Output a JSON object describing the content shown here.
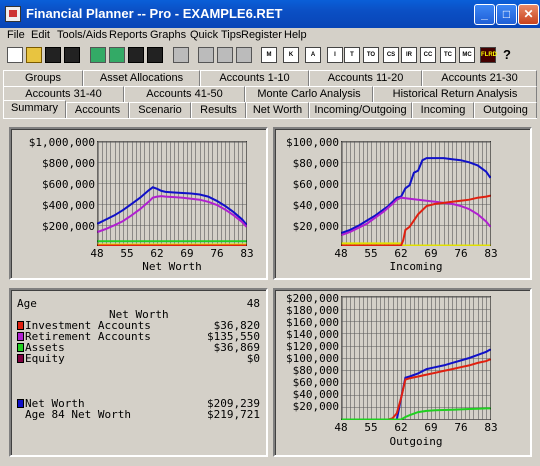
{
  "window": {
    "title": "Financial Planner -- Pro - EXAMPLE6.RET",
    "min": "_",
    "max": "□",
    "close": "✕"
  },
  "menu": [
    "File",
    "Edit",
    "Tools/Aids",
    "Reports",
    "Graphs",
    "Quick Tips",
    "Register",
    "Help"
  ],
  "toolbar": {
    "labeled_buttons": [
      "M",
      "K",
      "A",
      "I",
      "T",
      "TO",
      "CS",
      "IR",
      "CC",
      "TC",
      "MC",
      "FLRD"
    ],
    "other_icons": [
      "new-icon",
      "open-icon",
      "save-icon",
      "save-as-icon",
      "import-icon",
      "export-icon",
      "save-copy-icon",
      "save-all-icon",
      "print-icon",
      "print-setup-icon",
      "print-preview-icon",
      "print-report-icon",
      "help-icon"
    ]
  },
  "tabs": {
    "row1": [
      "Groups",
      "Asset Allocations",
      "Accounts 1-10",
      "Accounts 11-20",
      "Accounts 21-30"
    ],
    "row2": [
      "Accounts 31-40",
      "Accounts 41-50",
      "Monte Carlo Analysis",
      "Historical Return Analysis"
    ],
    "row3": [
      "Summary",
      "Accounts",
      "Scenario",
      "Results",
      "Net Worth",
      "Incoming/Outgoing",
      "Incoming",
      "Outgoing"
    ],
    "active": "Summary"
  },
  "colors": {
    "blue": "#1010c8",
    "purple": "#b020d0",
    "red": "#e02010",
    "green": "#20d020",
    "yellow": "#e0e000",
    "maroon": "#800040"
  },
  "chart_data": [
    {
      "type": "line",
      "xlabel": "Net Worth",
      "x_ticks": [
        "48",
        "55",
        "62",
        "69",
        "76",
        "83"
      ],
      "y_ticks": [
        "$1,000,000",
        "$800,000",
        "$600,000",
        "$400,000",
        "$200,000"
      ],
      "xlim": [
        48,
        83
      ],
      "ylim": [
        0,
        1000000
      ],
      "series": [
        {
          "color": "#1010c8",
          "x": [
            48,
            50,
            52,
            54,
            56,
            58,
            60,
            61,
            62,
            63,
            64,
            66,
            68,
            70,
            72,
            74,
            76,
            78,
            80,
            82,
            83
          ],
          "values": [
            210000,
            250000,
            290000,
            340000,
            400000,
            460000,
            530000,
            560000,
            545000,
            525000,
            515000,
            510000,
            505000,
            500000,
            490000,
            470000,
            430000,
            380000,
            320000,
            250000,
            200000
          ]
        },
        {
          "color": "#b020d0",
          "x": [
            48,
            50,
            52,
            54,
            56,
            58,
            60,
            61,
            62,
            63,
            64,
            66,
            68,
            70,
            72,
            74,
            76,
            78,
            80,
            82,
            83
          ],
          "values": [
            130000,
            160000,
            195000,
            235000,
            290000,
            350000,
            420000,
            460000,
            470000,
            475000,
            470000,
            465000,
            460000,
            450000,
            440000,
            420000,
            390000,
            345000,
            290000,
            225000,
            180000
          ]
        },
        {
          "color": "#20d020",
          "x": [
            48,
            83
          ],
          "values": [
            40000,
            40000
          ]
        },
        {
          "color": "#e0e000",
          "x": [
            48,
            83
          ],
          "values": [
            10000,
            10000
          ]
        },
        {
          "color": "#e02010",
          "x": [
            48,
            83
          ],
          "values": [
            0,
            0
          ]
        }
      ]
    },
    {
      "type": "line",
      "xlabel": "Incoming",
      "x_ticks": [
        "48",
        "55",
        "62",
        "69",
        "76",
        "83"
      ],
      "y_ticks": [
        "$100,000",
        "$80,000",
        "$60,000",
        "$40,000",
        "$20,000"
      ],
      "xlim": [
        48,
        83
      ],
      "ylim": [
        0,
        100000
      ],
      "series": [
        {
          "color": "#1010c8",
          "x": [
            48,
            50,
            52,
            54,
            56,
            58,
            59,
            60,
            61,
            62,
            63,
            64,
            65,
            66,
            67,
            68,
            70,
            72,
            74,
            76,
            78,
            80,
            82,
            83
          ],
          "values": [
            12000,
            15000,
            19000,
            24000,
            29000,
            35000,
            38000,
            42000,
            46000,
            47000,
            55000,
            58000,
            70000,
            72000,
            82000,
            84000,
            84000,
            84000,
            83000,
            82000,
            80000,
            77000,
            71000,
            65000
          ]
        },
        {
          "color": "#b020d0",
          "x": [
            48,
            50,
            52,
            54,
            56,
            58,
            60,
            61,
            62,
            64,
            66,
            68,
            70,
            72,
            74,
            76,
            78,
            80,
            82,
            83
          ],
          "values": [
            10000,
            13000,
            17000,
            21000,
            27000,
            33000,
            40000,
            44000,
            46000,
            45000,
            44000,
            43000,
            42000,
            41000,
            40000,
            38000,
            35000,
            30000,
            23000,
            18000
          ]
        },
        {
          "color": "#e0e000",
          "x": [
            48,
            62,
            62.1,
            83
          ],
          "values": [
            2000,
            2000,
            0,
            0
          ]
        },
        {
          "color": "#e02010",
          "x": [
            48,
            62,
            62.5,
            63,
            64,
            66,
            68,
            70,
            72,
            74,
            76,
            78,
            80,
            82,
            83
          ],
          "values": [
            0,
            0,
            5000,
            15000,
            18000,
            30000,
            38000,
            40000,
            41000,
            42000,
            43000,
            44000,
            46000,
            47000,
            48000
          ]
        }
      ]
    },
    {
      "type": "line",
      "xlabel": "Outgoing",
      "x_ticks": [
        "48",
        "55",
        "62",
        "69",
        "76",
        "83"
      ],
      "y_ticks": [
        "$200,000",
        "$180,000",
        "$160,000",
        "$140,000",
        "$120,000",
        "$100,000",
        "$80,000",
        "$60,000",
        "$40,000",
        "$20,000"
      ],
      "xlim": [
        48,
        83
      ],
      "ylim": [
        0,
        200000
      ],
      "series": [
        {
          "color": "#1010c8",
          "x": [
            48,
            61,
            62,
            63,
            64,
            66,
            68,
            70,
            72,
            74,
            76,
            78,
            80,
            82,
            83
          ],
          "values": [
            0,
            0,
            35000,
            68000,
            70000,
            75000,
            82000,
            85000,
            88000,
            92000,
            96000,
            100000,
            105000,
            110000,
            114000
          ]
        },
        {
          "color": "#e02010",
          "x": [
            48,
            59,
            60,
            61,
            62,
            63,
            64,
            66,
            68,
            70,
            72,
            74,
            76,
            78,
            80,
            82,
            83
          ],
          "values": [
            0,
            0,
            2000,
            10000,
            35000,
            65000,
            67000,
            70000,
            73000,
            76000,
            79000,
            82000,
            85000,
            88000,
            92000,
            95000,
            98000
          ]
        },
        {
          "color": "#20d020",
          "x": [
            48,
            62,
            63,
            64,
            66,
            68,
            70,
            72,
            74,
            76,
            78,
            80,
            82,
            83
          ],
          "values": [
            0,
            0,
            4000,
            7000,
            12000,
            14000,
            15000,
            15500,
            16000,
            16500,
            17000,
            17500,
            18000,
            18000
          ]
        }
      ]
    }
  ],
  "summary": {
    "age_label": "Age",
    "age_value": "48",
    "subtitle": "Net Worth",
    "items": [
      {
        "label": "Investment Accounts",
        "value": "$36,820",
        "color": "#e02010"
      },
      {
        "label": "Retirement Accounts",
        "value": "$135,550",
        "color": "#b020d0"
      },
      {
        "label": "Assets",
        "value": "$36,869",
        "color": "#20d020"
      },
      {
        "label": "Equity",
        "value": "$0",
        "color": "#800040"
      }
    ],
    "net_worth_label": "Net Worth",
    "net_worth_value": "$209,239",
    "age84_label": "Age 84 Net Worth",
    "age84_value": "$219,721"
  }
}
